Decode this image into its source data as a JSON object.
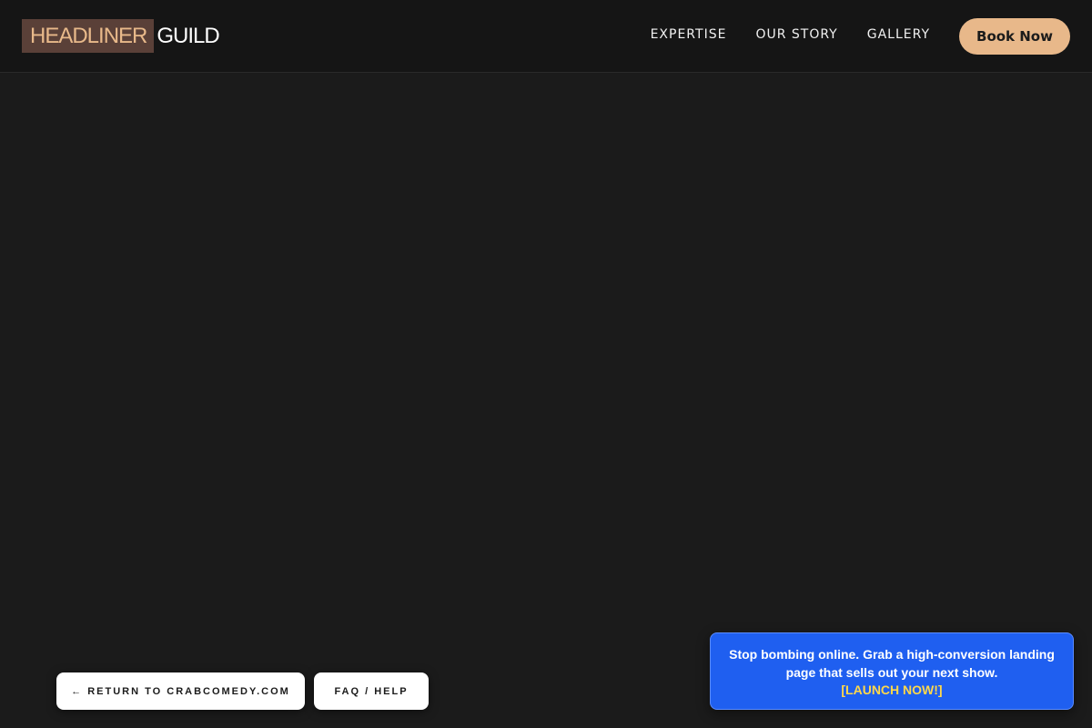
{
  "header": {
    "logo_highlight": "HEADLINER",
    "logo_text": "GUILD",
    "nav": [
      {
        "label": "EXPERTISE"
      },
      {
        "label": "OUR STORY"
      },
      {
        "label": "GALLERY"
      }
    ],
    "cta_label": "Book Now"
  },
  "footer_buttons": {
    "return_label": "← RETURN TO CRABCOMEDY.COM",
    "faq_label": "FAQ / HELP"
  },
  "promo": {
    "message": "Stop bombing online. Grab a high-conversion landing page that sells out your next show.",
    "link_label": "[LAUNCH NOW!]"
  },
  "colors": {
    "background": "#1b1b1b",
    "accent": "#e8b88a",
    "promo_blue": "#1f5ff0",
    "promo_link": "#ffd84a"
  }
}
